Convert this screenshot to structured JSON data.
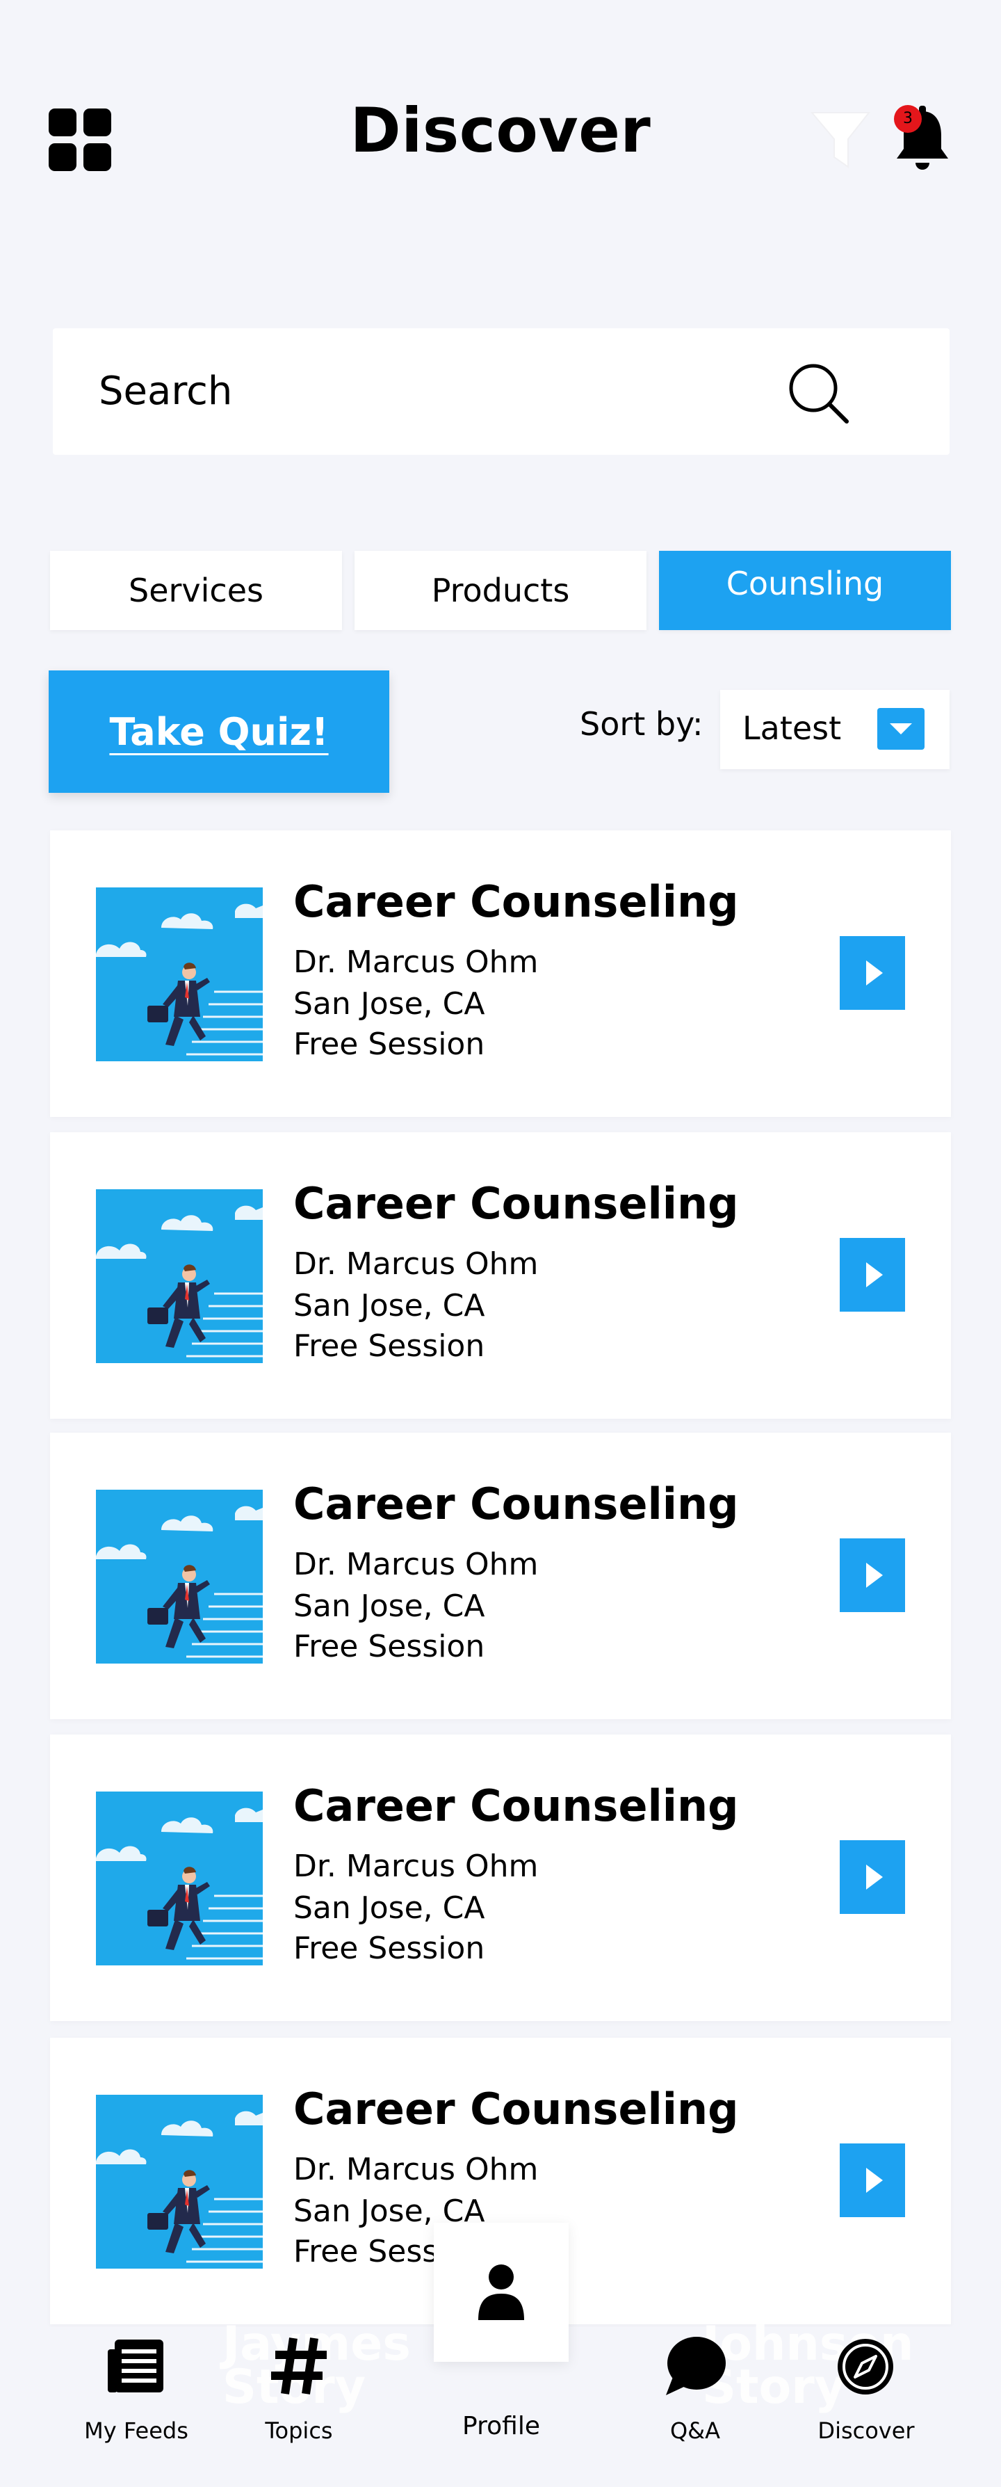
{
  "header": {
    "title": "Discover",
    "notification_count": "3"
  },
  "search": {
    "placeholder": "Search"
  },
  "tabs": [
    {
      "label": "Services",
      "active": false
    },
    {
      "label": "Products",
      "active": false
    },
    {
      "label": "Counsling",
      "active": true
    }
  ],
  "quiz": {
    "label": "Take Quiz!"
  },
  "sort": {
    "label": "Sort by:",
    "value": "Latest"
  },
  "cards": [
    {
      "title": "Career Counseling",
      "counselor": "Dr. Marcus Ohm",
      "location": "San Jose, CA",
      "price": "Free Session"
    },
    {
      "title": "Career Counseling",
      "counselor": "Dr. Marcus Ohm",
      "location": "San Jose, CA",
      "price": "Free Session"
    },
    {
      "title": "Career Counseling",
      "counselor": "Dr. Marcus Ohm",
      "location": "San Jose, CA",
      "price": "Free Session"
    },
    {
      "title": "Career Counseling",
      "counselor": "Dr. Marcus Ohm",
      "location": "San Jose, CA",
      "price": "Free Session"
    },
    {
      "title": "Career Counseling",
      "counselor": "Dr. Marcus Ohm",
      "location": "San Jose, CA",
      "price": "Free Session"
    }
  ],
  "bottom_nav": {
    "items": [
      {
        "label": "My Feeds",
        "icon": "feeds-icon"
      },
      {
        "label": "Topics",
        "icon": "hashtag-icon"
      },
      {
        "label": "Profile",
        "icon": "person-icon"
      },
      {
        "label": "Q&A",
        "icon": "chat-bubble-icon"
      },
      {
        "label": "Discover",
        "icon": "compass-icon"
      }
    ],
    "ghost_left": [
      "Jaymes",
      "Story"
    ],
    "ghost_right": [
      "Johnson",
      "Story"
    ]
  },
  "colors": {
    "accent": "#1da2f1",
    "background": "#f4f5fa",
    "badge": "#e4161b"
  }
}
